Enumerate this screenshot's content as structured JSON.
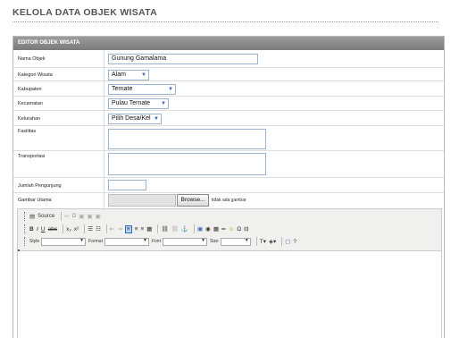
{
  "page": {
    "title": "KELOLA DATA OBJEK WISATA"
  },
  "panel": {
    "header": "EDITOR OBJEK WISATA"
  },
  "form": {
    "nama_objek": {
      "label": "Nama Objek",
      "value": "Gunung Gamalama"
    },
    "kategori": {
      "label": "Kategori Wisata",
      "value": "Alam"
    },
    "kabupaten": {
      "label": "Kabupaten",
      "value": "Ternate"
    },
    "kecamatan": {
      "label": "Kecamatan",
      "value": "Pulau Ternate"
    },
    "kelurahan": {
      "label": "Kelurahan",
      "value": "Pilih Desa/Kel"
    },
    "fasilitas": {
      "label": "Fasilitas",
      "value": ""
    },
    "transportasi": {
      "label": "Transportasi",
      "value": ""
    },
    "jumlah_pengunjung": {
      "label": "Jumlah Pengunjung",
      "value": ""
    },
    "gambar_utama": {
      "label": "Gambar Utama",
      "browse_label": "Browse...",
      "note": "tidak ada gambar"
    }
  },
  "editor": {
    "source_label": "Source",
    "style_label": "Style",
    "format_label": "Format",
    "font_label": "Font",
    "size_label": "Size",
    "icons": {
      "source": "source-icon",
      "cut": "cut-icon",
      "copy": "copy-icon",
      "paste": "paste-icon",
      "paste_text": "paste-text-icon",
      "paste_word": "paste-word-icon",
      "bold": "bold-icon",
      "italic": "italic-icon",
      "underline": "underline-icon",
      "strike": "strikethrough-icon",
      "subscript": "subscript-icon",
      "superscript": "superscript-icon",
      "ordered_list": "ordered-list-icon",
      "unordered_list": "unordered-list-icon",
      "outdent": "outdent-icon",
      "indent": "indent-icon",
      "align_left": "align-left-icon",
      "align_center": "align-center-icon",
      "align_right": "align-right-icon",
      "justify": "justify-icon",
      "link": "link-icon",
      "unlink": "unlink-icon",
      "anchor": "anchor-icon",
      "image": "image-icon",
      "flash": "flash-icon",
      "table": "table-icon",
      "hr": "horizontal-rule-icon",
      "smiley": "smiley-icon",
      "special_char": "special-char-icon",
      "page_break": "page-break-icon",
      "text_color": "text-color-icon",
      "bg_color": "background-color-icon",
      "maximize": "maximize-icon",
      "about": "about-icon"
    }
  }
}
